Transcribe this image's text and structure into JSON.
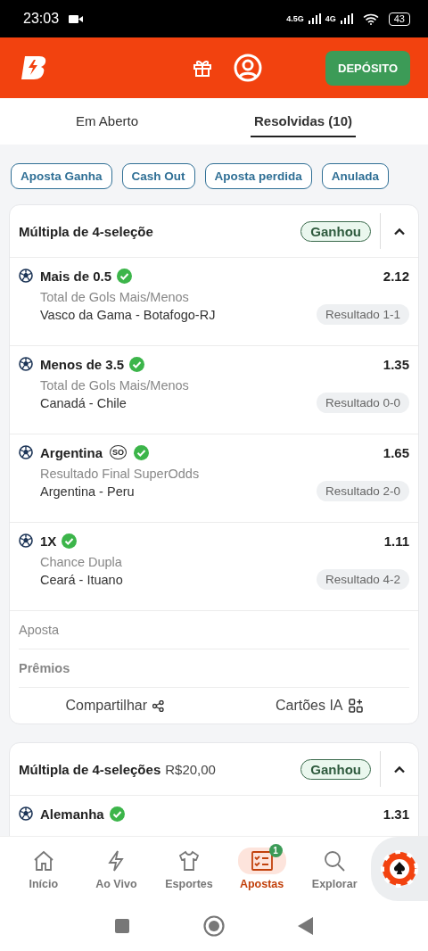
{
  "status_bar": {
    "time": "23:03",
    "network_1": "4.5G",
    "network_2": "4G",
    "battery": "43"
  },
  "header": {
    "deposit_button": "DEPÓSITO"
  },
  "tabs": [
    {
      "label": "Em Aberto",
      "selected": false
    },
    {
      "label": "Resolvidas (10)",
      "selected": true
    }
  ],
  "filters": [
    {
      "label": "Aposta Ganha",
      "selected": false
    },
    {
      "label": "Cash Out",
      "selected": false
    },
    {
      "label": "Aposta perdida",
      "selected": false
    },
    {
      "label": "Anulada",
      "selected": false
    }
  ],
  "bets": [
    {
      "title": "Múltipla de 4-seleçõe",
      "status": "Ganhou",
      "expanded": true,
      "selections": [
        {
          "pick": "Mais de 0.5",
          "won": true,
          "odds": "2.12",
          "market": "Total de Gols Mais/Menos",
          "match": "Vasco da Gama - Botafogo-RJ",
          "result": "Resultado 1-1"
        },
        {
          "pick": "Menos de 3.5",
          "won": true,
          "odds": "1.35",
          "market": "Total de Gols Mais/Menos",
          "match": "Canadá - Chile",
          "result": "Resultado 0-0"
        },
        {
          "pick": "Argentina",
          "badge": "SO",
          "won": true,
          "odds": "1.65",
          "market": "Resultado Final SuperOdds",
          "match": "Argentina - Peru",
          "result": "Resultado 2-0"
        },
        {
          "pick": "1X",
          "won": true,
          "odds": "1.11",
          "market": "Chance Dupla",
          "match": "Ceará - Ituano",
          "result": "Resultado 4-2"
        }
      ],
      "summary": [
        {
          "label": "Aposta",
          "bold": false
        },
        {
          "label": "Prêmios",
          "bold": true
        }
      ],
      "actions": [
        {
          "label": "Compartilhar",
          "kind": "share"
        },
        {
          "label": "Cartões IA",
          "kind": "cards"
        }
      ]
    },
    {
      "title": "Múltipla de 4-seleções",
      "amount": "R$20,00",
      "status": "Ganhou",
      "expanded": true,
      "selections": [
        {
          "pick": "Alemanha",
          "won": true,
          "odds": "1.31"
        }
      ]
    }
  ],
  "bottom_nav": [
    {
      "label": "Início",
      "selected": false
    },
    {
      "label": "Ao Vivo",
      "selected": false
    },
    {
      "label": "Esportes",
      "selected": false
    },
    {
      "label": "Apostas",
      "selected": true,
      "badge": "1"
    },
    {
      "label": "Explorar",
      "selected": false
    }
  ]
}
